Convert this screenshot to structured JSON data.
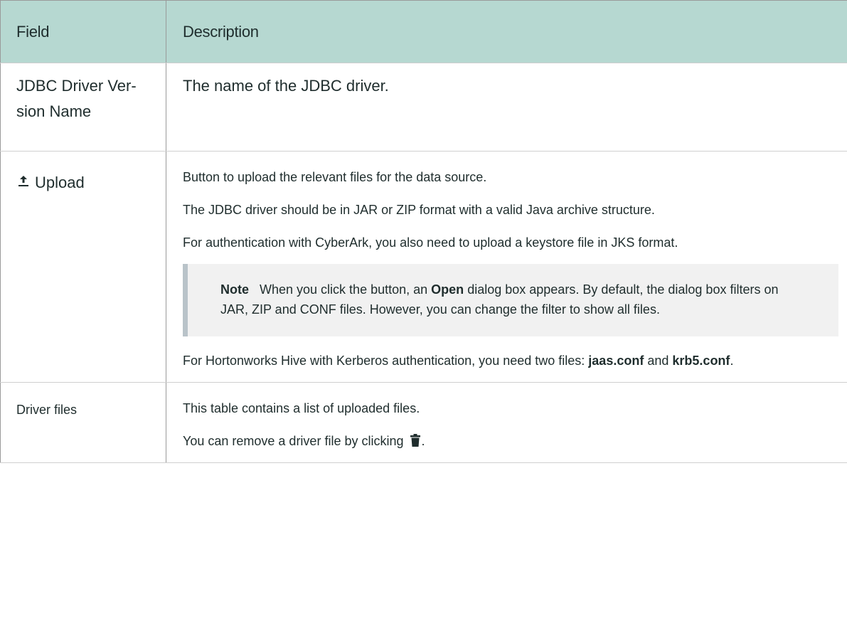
{
  "table": {
    "header": {
      "field": "Field",
      "description": "Description"
    },
    "rows": [
      {
        "field": "JDBC Driver Ver- sion Name",
        "field_lines": [
          "JDBC Driver Ver-",
          "sion Name"
        ],
        "description": "The name of the JDBC driver."
      },
      {
        "field": "Upload",
        "field_icon": "upload-icon",
        "paragraphs": [
          "Button to upload the relevant files for the data source.",
          "The JDBC driver should be in JAR or ZIP format with a valid Java archive structure.",
          "For authentication with CyberArk, you also need to upload a keystore file in JKS format."
        ],
        "note": {
          "label": "Note",
          "text_before": "When you click the button, an",
          "bold_word": "Open",
          "text_after": "dialog box appears. By default, the dialog box filters on JAR, ZIP and CONF files. However, you can change the filter to show all files."
        },
        "final_paragraph": {
          "text_before": "For Hortonworks Hive with Kerberos authentication, you need two files:",
          "file1": "jaas.conf",
          "middle": "and",
          "file2": "krb5.conf",
          "end": "."
        }
      },
      {
        "field": "Driver files",
        "paragraphs": [
          "This table contains a list of uploaded files."
        ],
        "remove_text_before": "You can remove a driver file by clicking",
        "remove_icon": "trash-icon",
        "remove_text_after": "."
      }
    ]
  }
}
